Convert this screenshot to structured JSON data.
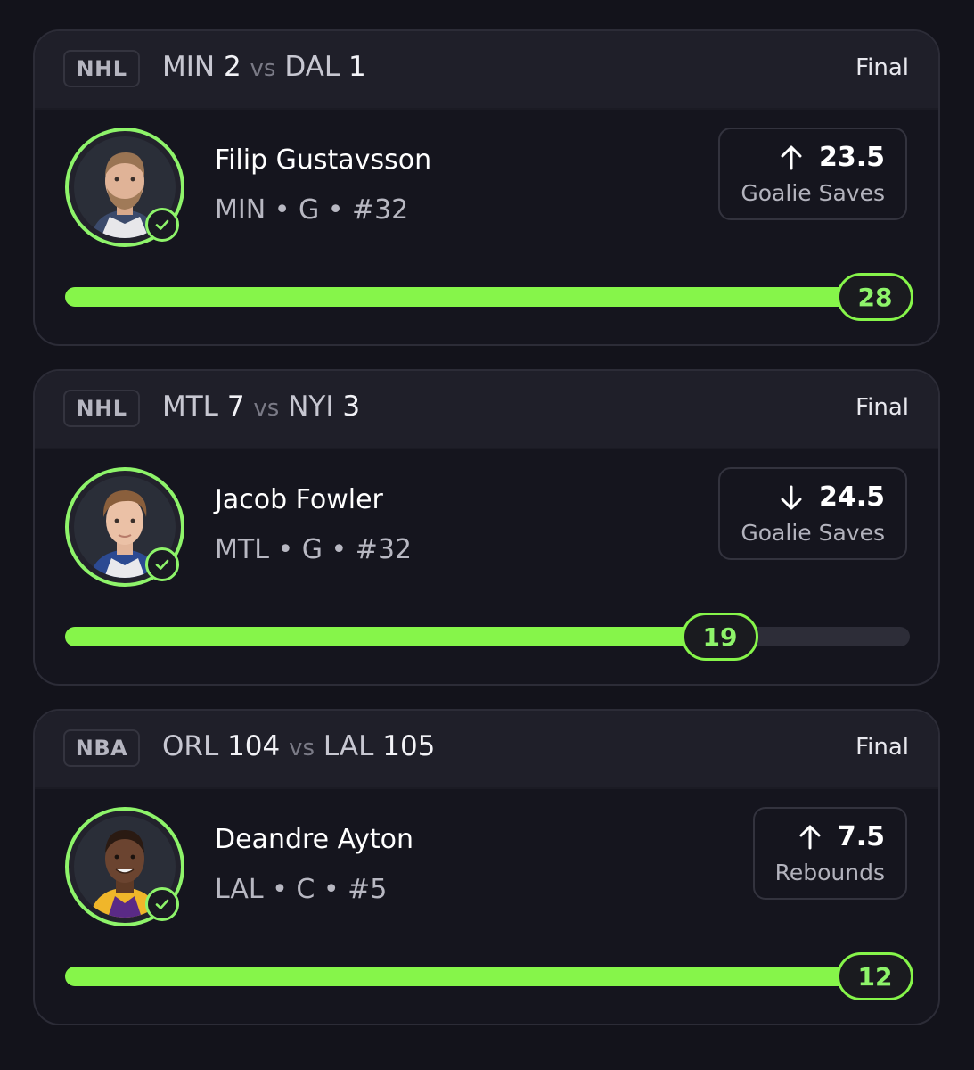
{
  "cards": [
    {
      "league": "NHL",
      "away_team": "MIN",
      "away_score": "2",
      "vs": "vs",
      "home_team": "DAL",
      "home_score": "1",
      "status": "Final",
      "player": {
        "name": "Filip Gustavsson",
        "meta": "MIN • G • #32"
      },
      "prop": {
        "direction": "up-arrow-icon",
        "line": "23.5",
        "stat": "Goalie Saves"
      },
      "result": "28",
      "progress_fraction": 1.0
    },
    {
      "league": "NHL",
      "away_team": "MTL",
      "away_score": "7",
      "vs": "vs",
      "home_team": "NYI",
      "home_score": "3",
      "status": "Final",
      "player": {
        "name": "Jacob Fowler",
        "meta": "MTL • G • #32"
      },
      "prop": {
        "direction": "down-arrow-icon",
        "line": "24.5",
        "stat": "Goalie Saves"
      },
      "result": "19",
      "progress_fraction": 0.775
    },
    {
      "league": "NBA",
      "away_team": "ORL",
      "away_score": "104",
      "vs": "vs",
      "home_team": "LAL",
      "home_score": "105",
      "status": "Final",
      "player": {
        "name": "Deandre Ayton",
        "meta": "LAL • C • #5"
      },
      "prop": {
        "direction": "up-arrow-icon",
        "line": "7.5",
        "stat": "Rebounds"
      },
      "result": "12",
      "progress_fraction": 1.0
    }
  ],
  "colors": {
    "accent_green": "#86f54a",
    "background": "#13131b",
    "card_header": "#1f1f29"
  }
}
